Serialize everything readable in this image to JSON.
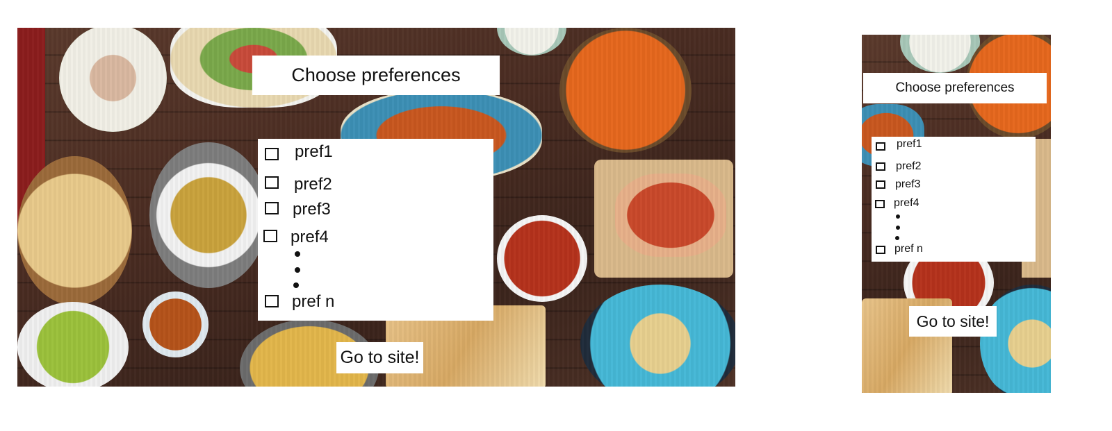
{
  "desktop": {
    "title": "Choose preferences",
    "preferences": [
      "pref1",
      "pref2",
      "pref3",
      "pref4",
      "pref n"
    ],
    "button_label": "Go to site!"
  },
  "mobile": {
    "title": "Choose preferences",
    "preferences": [
      "pref1",
      "pref2",
      "pref3",
      "pref4",
      "pref n"
    ],
    "button_label": "Go to site!"
  },
  "colors": {
    "panel": "#ffffff",
    "text": "#111111",
    "background_wood": "#4a2c22"
  },
  "icons": {
    "checkbox": "empty-square",
    "ellipsis": "vertical-dots"
  }
}
